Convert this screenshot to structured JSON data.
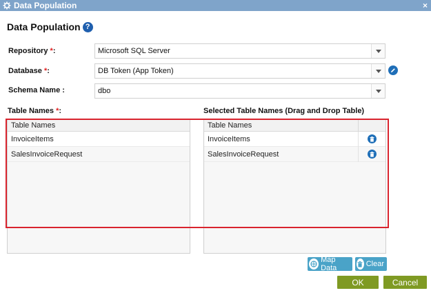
{
  "window": {
    "title": "Data Population",
    "close_glyph": "×",
    "icon": "gear-icon"
  },
  "page": {
    "title": "Data Population",
    "help_glyph": "?"
  },
  "form": {
    "repository": {
      "label": "Repository",
      "required_mark": "*",
      "suffix": ":",
      "value": "Microsoft SQL Server"
    },
    "database": {
      "label": "Database",
      "required_mark": "*",
      "suffix": ":",
      "value": "DB Token (App Token)"
    },
    "schema": {
      "label": "Schema Name :",
      "value": "dbo"
    }
  },
  "tables": {
    "left_label": "Table Names",
    "left_required": "*",
    "left_suffix": ":",
    "right_label": "Selected Table Names (Drag and Drop Table)",
    "left_header": "Table Names",
    "right_header": "Table Names",
    "left_rows": [
      "InvoiceItems",
      "SalesInvoiceRequest"
    ],
    "right_rows": [
      "InvoiceItems",
      "SalesInvoiceRequest"
    ]
  },
  "actions": {
    "map_data_label": "Map Data",
    "clear_label": "Clear",
    "ok_label": "OK",
    "cancel_label": "Cancel"
  },
  "colors": {
    "titlebar": "#7fa4ca",
    "accent_blue": "#1f6fb8",
    "action_button": "#4aa3c8",
    "primary_button": "#7f9a23",
    "required": "#e02020",
    "highlight": "#d9232d"
  }
}
